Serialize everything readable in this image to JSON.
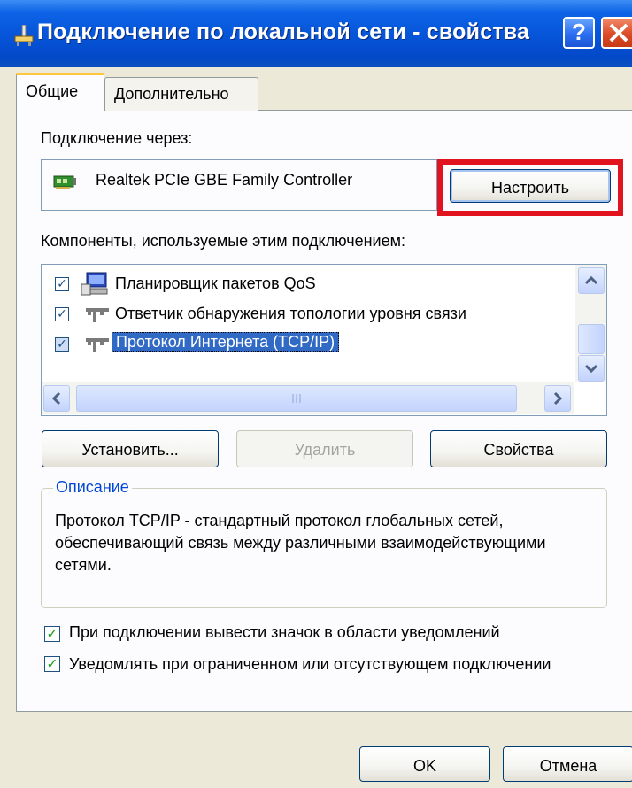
{
  "window": {
    "title": "Подключение по локальной сети - свойства",
    "help_label": "?",
    "colors": {
      "titlebar": "#0654d8",
      "close": "#dc4a26",
      "highlight": "#e0131f",
      "selection": "#316ac5"
    }
  },
  "tabs": [
    {
      "label": "Общие",
      "active": true
    },
    {
      "label": "Дополнительно",
      "active": false
    }
  ],
  "general": {
    "connect_using_label": "Подключение через:",
    "adapter": {
      "icon": "network-card-icon",
      "name": "Realtek PCIe GBE Family Controller"
    },
    "configure_label": "Настроить",
    "components_label": "Компоненты, используемые этим подключением:",
    "components": [
      {
        "label": "Планировщик пакетов QoS",
        "checked": true,
        "icon": "qos-scheduler-icon",
        "selected": false
      },
      {
        "label": "Ответчик обнаружения топологии уровня связи",
        "checked": true,
        "icon": "network-protocol-icon",
        "selected": false
      },
      {
        "label": "Протокол Интернета (TCP/IP)",
        "checked": true,
        "icon": "network-protocol-icon",
        "selected": true
      }
    ],
    "install_label": "Установить...",
    "remove_label": "Удалить",
    "properties_label": "Свойства",
    "description_legend": "Описание",
    "description_text": "Протокол TCP/IP - стандартный протокол глобальных сетей, обеспечивающий связь между различными взаимодействующими сетями.",
    "options": [
      {
        "label": "При подключении вывести значок в области уведомлений",
        "checked": true
      },
      {
        "label": "Уведомлять при ограниченном или отсутствующем подключении",
        "checked": true
      }
    ]
  },
  "footer": {
    "ok_label": "OK",
    "cancel_label": "Отмена"
  }
}
